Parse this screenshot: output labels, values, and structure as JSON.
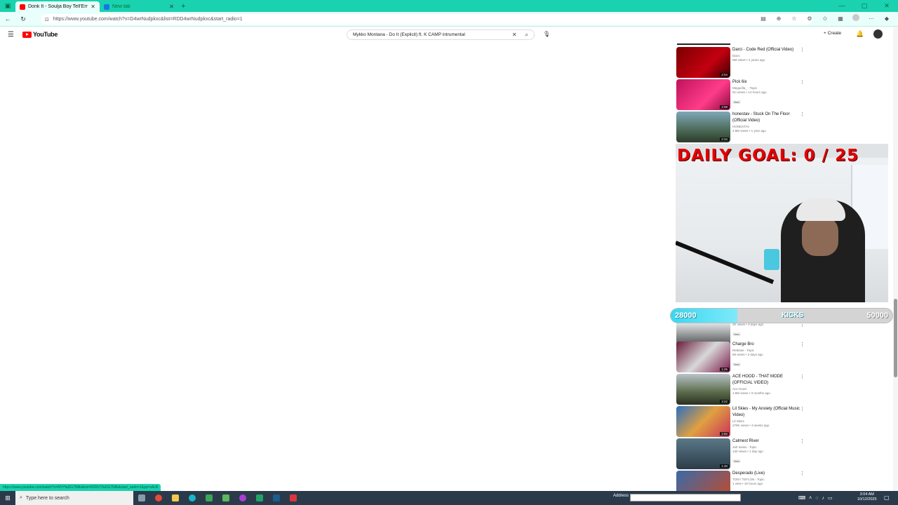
{
  "browser": {
    "tabs": [
      {
        "title": "Donk It - Soulja Boy Tell'Em",
        "active": true
      },
      {
        "title": "New tab",
        "active": false
      }
    ],
    "url": "https://www.youtube.com/watch?v=D4wrNudpkxc&list=RDD4wrNudpkxc&start_radio=1",
    "status_url": "https://www.youtube.com/watch?v=RVYfaDG7N8k&list=RDRVYfaDG7N8k&start_radio=1&pp=oAcB"
  },
  "youtube": {
    "logo_text": "YouTube",
    "search_value": "Mykko Montana - Do It (Explicit) ft. K CAMP intrumental",
    "create_label": "Create"
  },
  "videos": [
    {
      "title": "Darci - Code Red (Official Video)",
      "channel": "Darci",
      "stats": "5M views • 2 years ago",
      "duration": "2:04",
      "is_new": false
    },
    {
      "title": "Pick 6ix",
      "channel": "Meguella_ - Topic",
      "stats": "No views • 14 hours ago",
      "duration": "2:08",
      "is_new": true
    },
    {
      "title": "honestav - Stuck On The Floor (Official Video)",
      "channel": "HONESTAV",
      "stats": "4.8M views • 1 year ago",
      "duration": "2:34",
      "is_new": false
    },
    {
      "title": "Adam Oh - GO STUPID GO",
      "channel": "",
      "stats": "",
      "duration": "",
      "is_new": false
    },
    {
      "title": "",
      "channel": "",
      "stats": "2K views • 3 days ago",
      "duration": "3:27",
      "is_new": true
    },
    {
      "title": "Charge Bro",
      "channel": "Release - Topic",
      "stats": "98 views • 3 days ago",
      "duration": "1:25",
      "is_new": true
    },
    {
      "title": "ACE HOOD - THAT MODE (OFFICIAL VIDEO)",
      "channel": "Ace Hood",
      "stats": "1.5M views • 3 months ago",
      "duration": "3:22",
      "is_new": false
    },
    {
      "title": "Lil Skies - My Anxiety (Official Music Video)",
      "channel": "Lil Skies",
      "stats": "279K views • 3 weeks ago",
      "duration": "2:50",
      "is_new": false
    },
    {
      "title": "Calmest River",
      "channel": "Jah Swiss - Topic",
      "stats": "130 views • 1 day ago",
      "duration": "1:40",
      "is_new": true
    },
    {
      "title": "Desperado (Live)",
      "channel": "TONY TEFLON - Topic",
      "stats": "1 view • 16 hours ago",
      "duration": "",
      "is_new": false
    }
  ],
  "new_badge": "New",
  "overlay": {
    "goal_text": "DAILY GOAL: 0 / 25",
    "kicks_start": "28000",
    "kicks_label": "KICKS",
    "kicks_end": "50000",
    "progress": 0.3
  },
  "taskbar": {
    "search_placeholder": "Type here to search",
    "address_label": "Address",
    "time": "3:04 AM",
    "date": "10/12/2025"
  }
}
